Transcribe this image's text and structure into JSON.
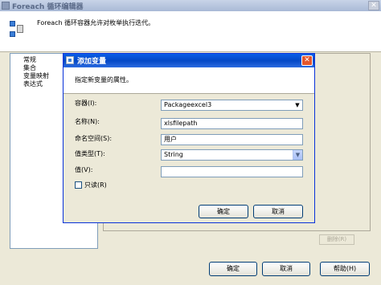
{
  "outer": {
    "title": "Foreach 循环编辑器",
    "description": "Foreach 循环容器允许对枚举执行迭代。",
    "close_label": "✕",
    "nav_items": [
      "常规",
      "集合",
      "变量映射",
      "表达式"
    ],
    "remove_label": "删除(R)",
    "ok_label": "确定",
    "cancel_label": "取消",
    "help_label": "帮助(H)"
  },
  "dialog": {
    "title": "添加变量",
    "close_label": "✕",
    "header_text": "指定新变量的属性。",
    "container_label": "容器(I):",
    "container_value": "Packageexcel3",
    "name_label": "名称(N):",
    "name_value": "xlsfilepath",
    "namespace_label": "命名空间(S):",
    "namespace_value": "用户",
    "value_type_label": "值类型(T):",
    "value_type_value": "String",
    "value_label": "值(V):",
    "value_value": "",
    "readonly_label": "只读(R)",
    "readonly_checked": false,
    "ok_label": "确定",
    "cancel_label": "取消"
  }
}
